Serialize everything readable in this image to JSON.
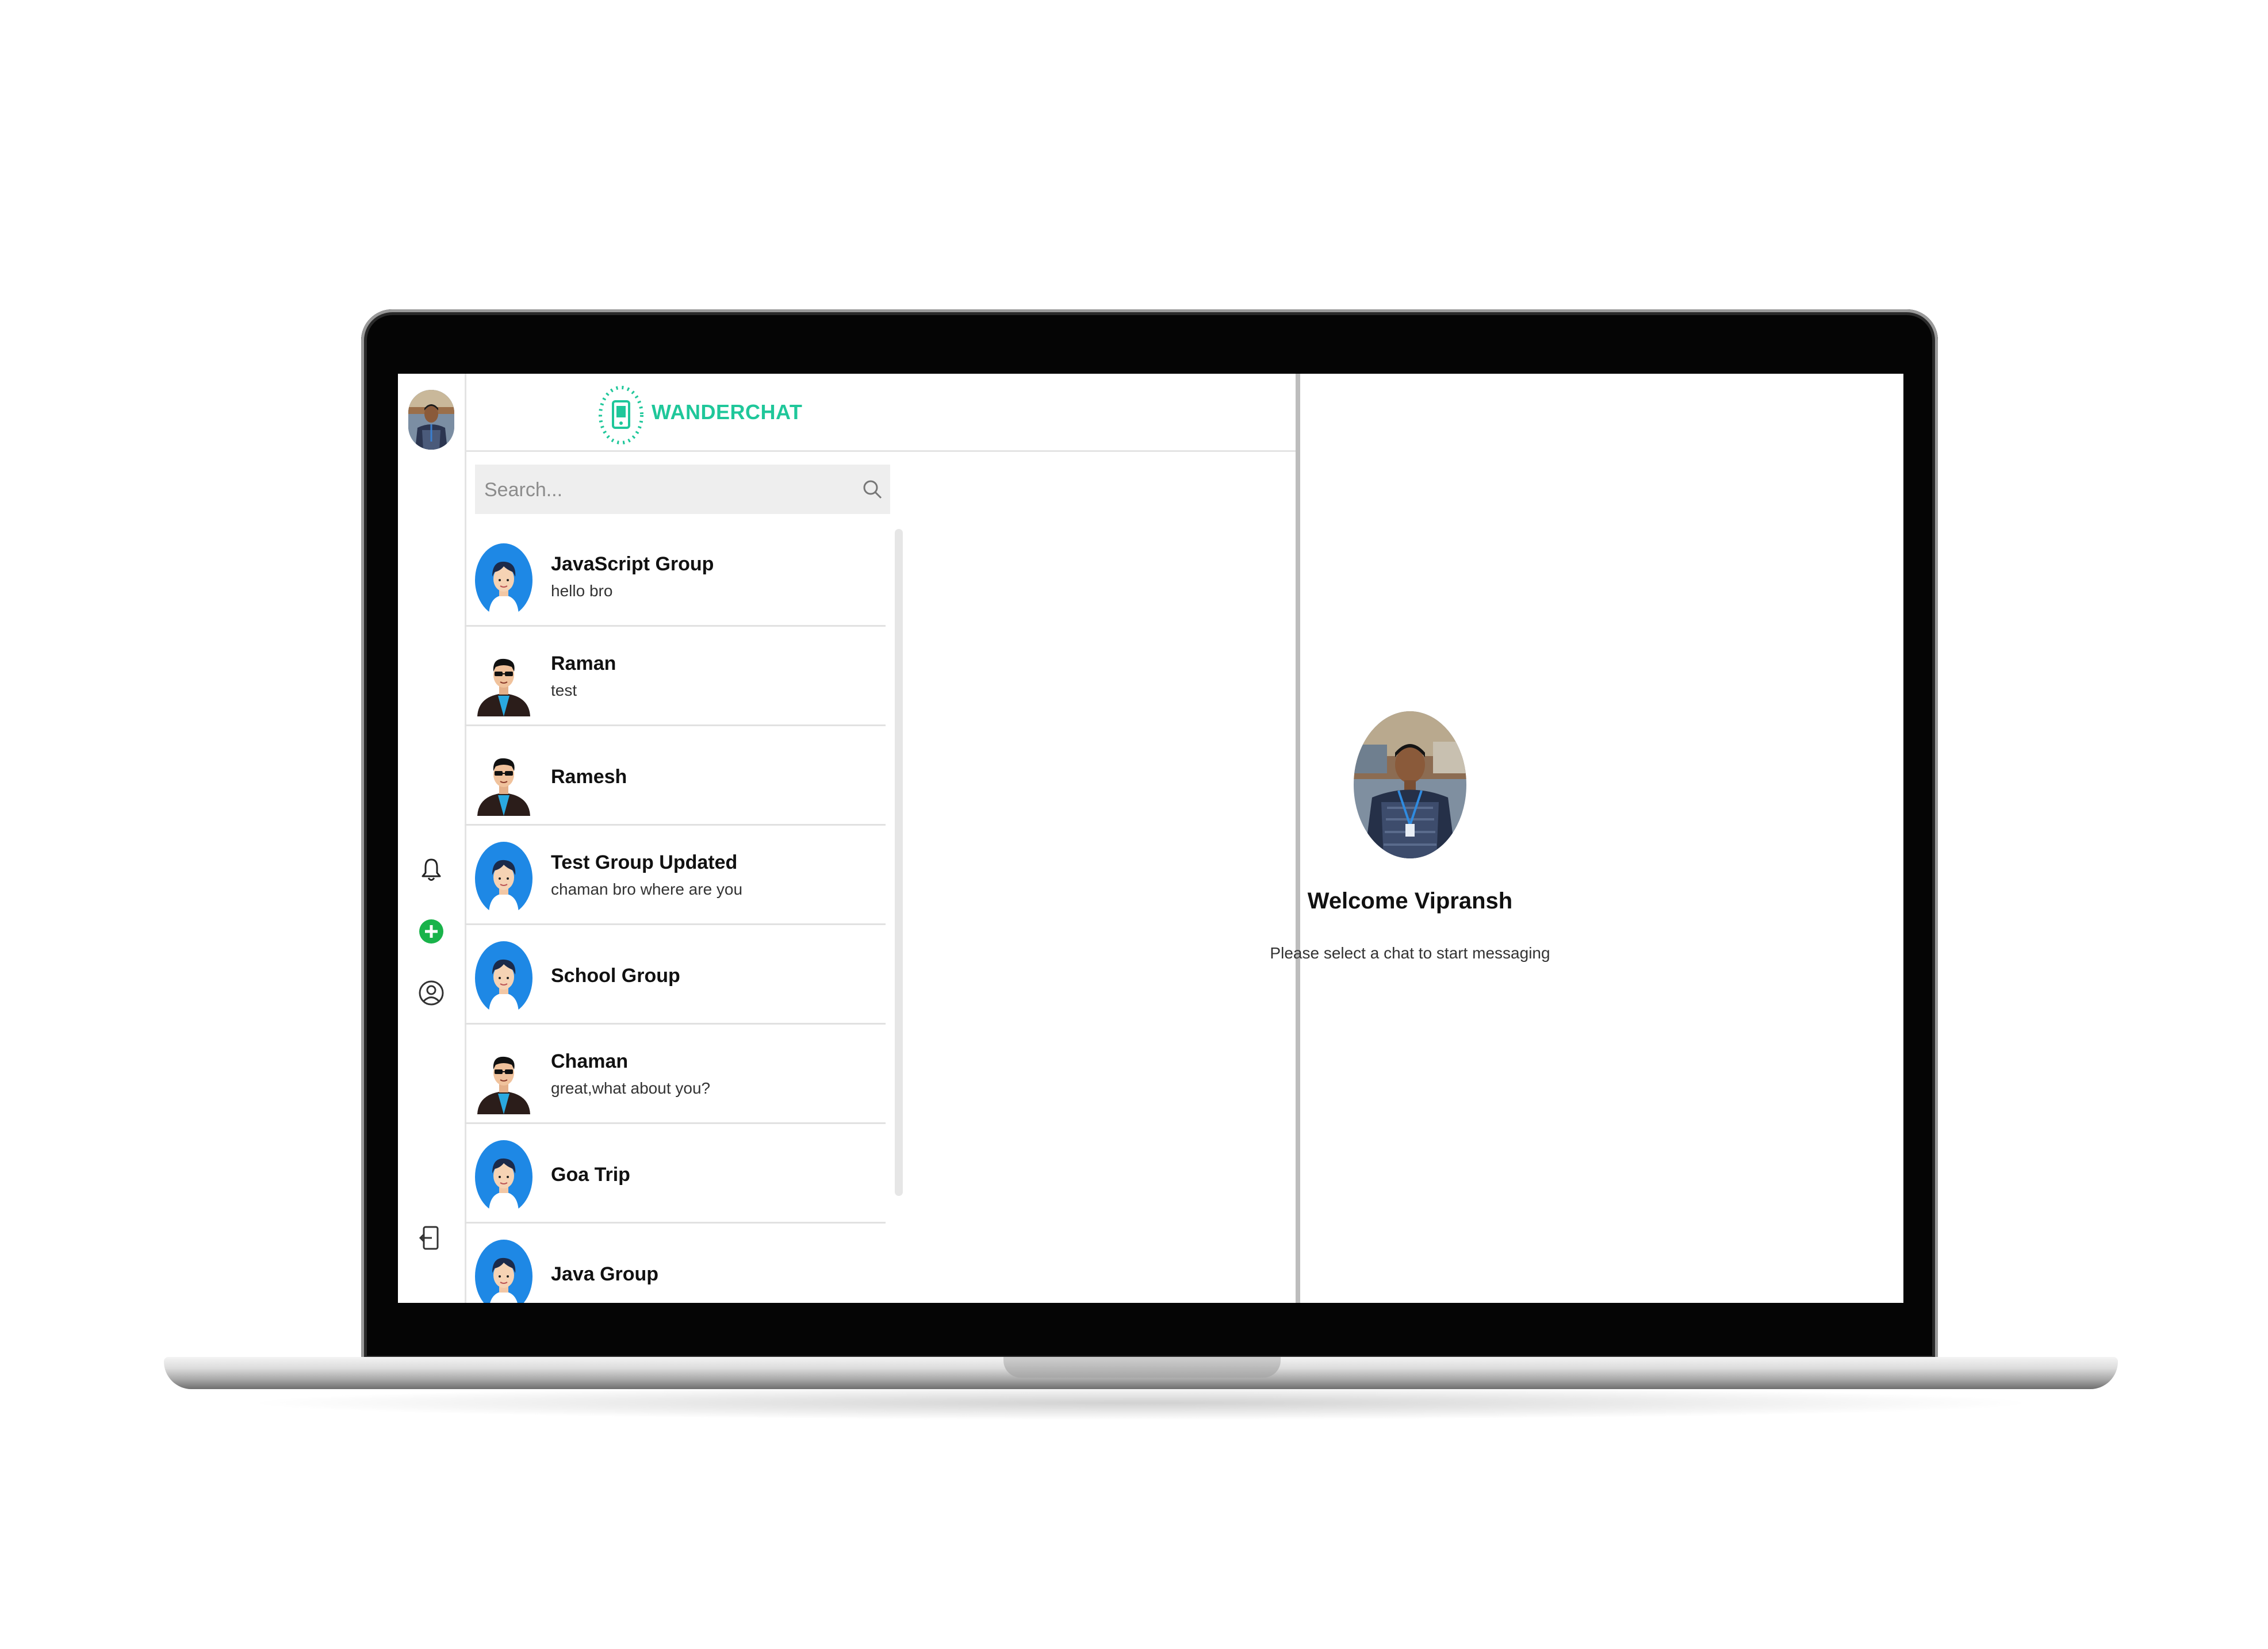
{
  "app": {
    "title": "WANDERCHAT",
    "brand_color": "#1fc79a"
  },
  "rail": {
    "icons": [
      "bell-icon",
      "plus-circle-icon",
      "user-circle-icon",
      "logout-icon"
    ],
    "plus_color": "#19b34a"
  },
  "search": {
    "placeholder": "Search..."
  },
  "chats": [
    {
      "name": "JavaScript Group",
      "last_message": "hello bro",
      "avatar": "group-avatar"
    },
    {
      "name": "Raman",
      "last_message": "test",
      "avatar": "user-avatar"
    },
    {
      "name": "Ramesh",
      "last_message": "",
      "avatar": "user-avatar"
    },
    {
      "name": "Test Group Updated",
      "last_message": "chaman bro where are you",
      "avatar": "group-avatar"
    },
    {
      "name": "School Group",
      "last_message": "",
      "avatar": "group-avatar"
    },
    {
      "name": "Chaman",
      "last_message": "great,what about you?",
      "avatar": "user-avatar"
    },
    {
      "name": "Goa Trip",
      "last_message": "",
      "avatar": "group-avatar"
    },
    {
      "name": "Java Group",
      "last_message": "",
      "avatar": "group-avatar"
    }
  ],
  "main": {
    "welcome": "Welcome Vipransh",
    "hint": "Please select a chat to start messaging"
  }
}
